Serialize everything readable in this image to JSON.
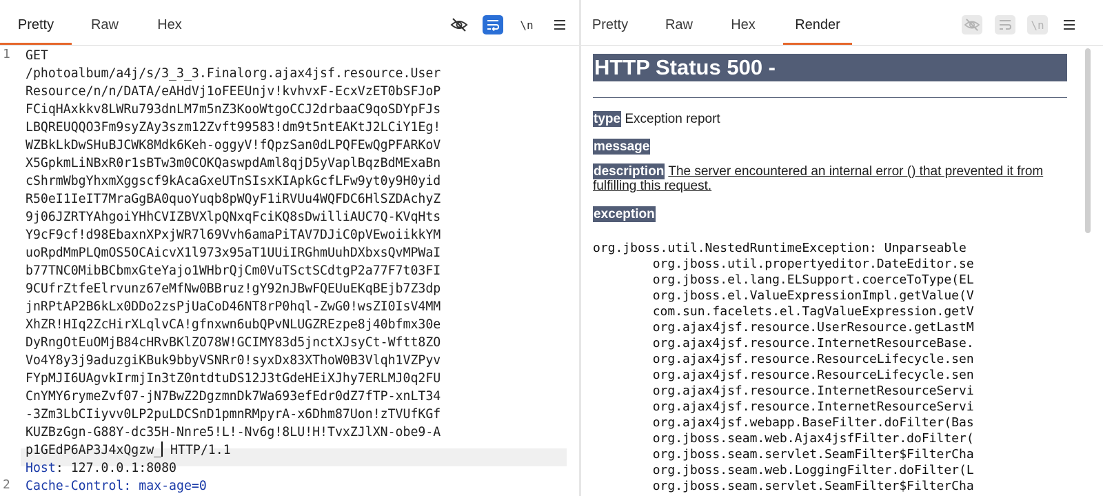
{
  "request": {
    "tabs": [
      "Pretty",
      "Raw",
      "Hex"
    ],
    "active_tab": "Pretty",
    "newline_toggle_label": "\\n",
    "line_numbers": [
      "1",
      "2"
    ],
    "line1_wrapped": [
      "GET",
      "/photoalbum/a4j/s/3_3_3.Finalorg.ajax4jsf.resource.User",
      "Resource/n/n/DATA/eAHdVj1oFEEUnjv!kvhvxF-EcxVzET0bSFJoP",
      "FCiqHAxkkv8LWRu793dnLM7m5nZ3KooWtgoCCJ2drbaaC9qoSDYpFJs",
      "LBQREUQQO3Fm9syZAy3szm12Zvft99583!dm9t5ntEAKtJ2LCiY1Eg!",
      "WZBkLkDwSHuBJCWK8Mdk6Keh-oggyV!fQpzSan0dLPQFEwQgPFARKoV",
      "X5GpkmLiNBxR0r1sBTw3m0COKQaswpdAml8qjD5yVaplBqzBdMExaBn",
      "cShrmWbgYhxmXggscf9kAcaGxeUTnSIsxKIApkGcfLFw9yt0y9H0yid",
      "R50eI1IeIT7MraGgBA0quoYuqb8pWQyF1iRVUu4WQFDC6HlSZDAchyZ",
      "9j06JZRTYAhgoiYHhCVIZBVXlpQNxqFciKQ8sDwilliAUC7Q-KVqHts",
      "Y9cF9cf!d98EbaxnXPxjWR7l69Vvh6amaPiTAV7DJiC0pVEwoiikkYM",
      "uoRpdMmPLQmOS5OCAicvX1l973x95aT1UUiIRGhmUuhDXbxsQvMPWaI",
      "b77TNC0MibBCbmxGteYajo1WHbrQjCm0VuTSctSCdtgP2a77F7t03FI",
      "9CUfrZtfeElrvunz67eMfNw0BBruz!gY92nJBwFQEUuEKqBEjb7Z3dp",
      "jnRPtAP2B6kLx0DDo2zsPjUaCoD46NT8rP0hql-ZwG0!wsZI0IsV4MM",
      "XhZR!HIq2ZcHirXLqlvCA!gfnxwn6ubQPvNLUGZREzpe8j40bfmx30e",
      "DyRngOtEuOMjB84cHRvBKlZO78W!GCIMY83d5jnctXJsyCt-Wftt8ZO",
      "Vo4Y8y3j9aduzgiKBuk9bbyVSNRr0!syxDx83XThoW0B3Vlqh1VZPyv",
      "FYpMJI6UAgvkIrmjIn3tZ0ntdtuDS12J3tGdeHEiXJhy7ERLMJ0q2FU",
      "CnYMY6rymeZvf07-jN7BwZ2DgzmnDk7Wa693efEdr0dZ7fTP-xnLT34",
      "-3Zm3LbCIiyvv0LP2puLDCSnD1pmnRMpyrA-x6Dhm87Uon!zTVUfKGf",
      "KUZBzGgn-G88Y-dc35H-Nnre5!L!-Nv6g!8LU!H!TvxZJlXN-obe9-A",
      "p1GEdP6AP3J4xQgzw_"
    ],
    "line1_tail": " HTTP/1.1",
    "line2_name": "Host",
    "line2_value": ": 127.0.0.1:8080",
    "line3_partial": "Cache-Control: max-age=0"
  },
  "response": {
    "tabs": [
      "Pretty",
      "Raw",
      "Hex",
      "Render"
    ],
    "active_tab": "Render",
    "newline_toggle_label": "\\n",
    "h1": "HTTP Status 500 -",
    "type_label": "type",
    "type_value": " Exception report",
    "message_label": "message",
    "description_label": "description",
    "description_text": "The server encountered an internal error () that prevented it from fulfilling this request.",
    "exception_label": "exception",
    "stack": [
      "org.jboss.util.NestedRuntimeException: Unparseable",
      "        org.jboss.util.propertyeditor.DateEditor.se",
      "        org.jboss.el.lang.ELSupport.coerceToType(EL",
      "        org.jboss.el.ValueExpressionImpl.getValue(V",
      "        com.sun.facelets.el.TagValueExpression.getV",
      "        org.ajax4jsf.resource.UserResource.getLastM",
      "        org.ajax4jsf.resource.InternetResourceBase.",
      "        org.ajax4jsf.resource.ResourceLifecycle.sen",
      "        org.ajax4jsf.resource.ResourceLifecycle.sen",
      "        org.ajax4jsf.resource.InternetResourceServi",
      "        org.ajax4jsf.resource.InternetResourceServi",
      "        org.ajax4jsf.webapp.BaseFilter.doFilter(Bas",
      "        org.jboss.seam.web.Ajax4jsfFilter.doFilter(",
      "        org.jboss.seam.servlet.SeamFilter$FilterCha",
      "        org.jboss.seam.web.LoggingFilter.doFilter(L",
      "        org.jboss.seam.servlet.SeamFilter$FilterCha"
    ]
  },
  "colors": {
    "accent_tab": "#e5672c",
    "wrap_toggle_on": "#2a6fd6",
    "tomcat_header": "#525d76",
    "header_name": "#1a3aa8"
  },
  "icons": {
    "hide_nonprintable": "eye-off-icon",
    "wrap_lines": "wrap-lines-icon",
    "menu": "hamburger-menu-icon"
  }
}
